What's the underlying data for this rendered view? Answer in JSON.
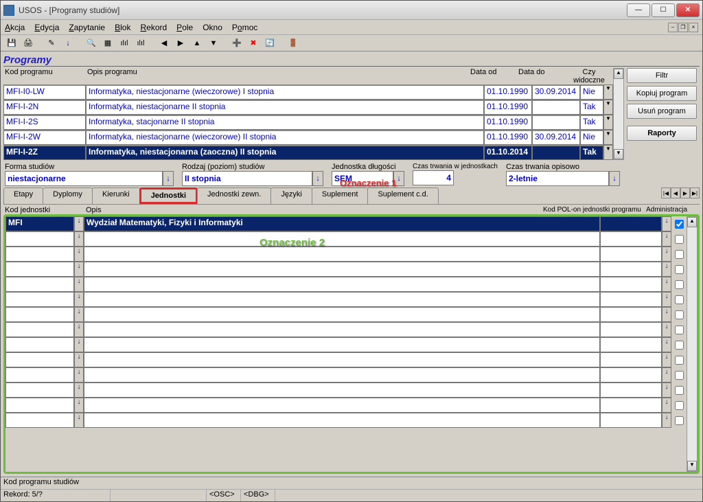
{
  "window": {
    "title": "USOS - [Programy studiów]"
  },
  "menu": [
    "Akcja",
    "Edycja",
    "Zapytanie",
    "Blok",
    "Rekord",
    "Pole",
    "Okno",
    "Pomoc"
  ],
  "section_title": "Programy",
  "columns": {
    "kod": "Kod programu",
    "opis": "Opis programu",
    "data_od": "Data od",
    "data_do": "Data do",
    "widoczne": "Czy widoczne"
  },
  "programs": [
    {
      "kod": "MFI-I0-LW",
      "opis": "Informatyka, niestacjonarne (wieczorowe) I stopnia",
      "od": "01.10.1990",
      "do": "30.09.2014",
      "vis": "Nie",
      "sel": false
    },
    {
      "kod": "MFI-I-2N",
      "opis": "Informatyka, niestacjonarne II stopnia",
      "od": "01.10.1990",
      "do": "",
      "vis": "Tak",
      "sel": false
    },
    {
      "kod": "MFI-I-2S",
      "opis": "Informatyka, stacjonarne II stopnia",
      "od": "01.10.1990",
      "do": "",
      "vis": "Tak",
      "sel": false
    },
    {
      "kod": "MFI-I-2W",
      "opis": "Informatyka, niestacjonarne (wieczorowe) II stopnia",
      "od": "01.10.1990",
      "do": "30.09.2014",
      "vis": "Nie",
      "sel": false
    },
    {
      "kod": "MFI-I-2Z",
      "opis": "Informatyka, niestacjonarna (zaoczna) II stopnia",
      "od": "01.10.2014",
      "do": "",
      "vis": "Tak",
      "sel": true
    }
  ],
  "side_buttons": [
    "Filtr",
    "Kopiuj program",
    "Usuń program",
    "Raporty"
  ],
  "props": {
    "forma_label": "Forma studiów",
    "forma": "niestacjonarne",
    "rodzaj_label": "Rodzaj (poziom) studiów",
    "rodzaj": "II stopnia",
    "jedn_dl_label": "Jednostka długości",
    "jedn_dl": "SEM",
    "czas_jedn_label": "Czas trwania w jednostkach",
    "czas_jedn": "4",
    "czas_opis_label": "Czas trwania opisowo",
    "czas_opis": "2-letnie"
  },
  "tabs": [
    "Etapy",
    "Dyplomy",
    "Kierunki",
    "Jednostki",
    "Jednostki zewn.",
    "Języki",
    "Suplement",
    "Suplement c.d."
  ],
  "active_tab": 3,
  "annotations": {
    "a1": "Oznaczenie 1",
    "a2": "Oznaczenie 2"
  },
  "sub_columns": {
    "kod": "Kod jednostki",
    "opis": "Opis",
    "pol": "Kod POL-on jednostki programu",
    "admin": "Administracja"
  },
  "sub_rows": [
    {
      "kod": "MFI",
      "opis": "Wydział Matematyki, Fizyki i Informatyki",
      "pol": "",
      "admin": true,
      "sel": true
    },
    {
      "kod": "",
      "opis": "",
      "pol": "",
      "admin": false,
      "sel": false
    },
    {
      "kod": "",
      "opis": "",
      "pol": "",
      "admin": false,
      "sel": false
    },
    {
      "kod": "",
      "opis": "",
      "pol": "",
      "admin": false,
      "sel": false
    },
    {
      "kod": "",
      "opis": "",
      "pol": "",
      "admin": false,
      "sel": false
    },
    {
      "kod": "",
      "opis": "",
      "pol": "",
      "admin": false,
      "sel": false
    },
    {
      "kod": "",
      "opis": "",
      "pol": "",
      "admin": false,
      "sel": false
    },
    {
      "kod": "",
      "opis": "",
      "pol": "",
      "admin": false,
      "sel": false
    },
    {
      "kod": "",
      "opis": "",
      "pol": "",
      "admin": false,
      "sel": false
    },
    {
      "kod": "",
      "opis": "",
      "pol": "",
      "admin": false,
      "sel": false
    },
    {
      "kod": "",
      "opis": "",
      "pol": "",
      "admin": false,
      "sel": false
    },
    {
      "kod": "",
      "opis": "",
      "pol": "",
      "admin": false,
      "sel": false
    },
    {
      "kod": "",
      "opis": "",
      "pol": "",
      "admin": false,
      "sel": false
    },
    {
      "kod": "",
      "opis": "",
      "pol": "",
      "admin": false,
      "sel": false
    }
  ],
  "status": {
    "line1": "Kod programu studiów",
    "rec": "Rekord: 5/?",
    "osc": "<OSC>",
    "dbg": "<DBG>"
  }
}
